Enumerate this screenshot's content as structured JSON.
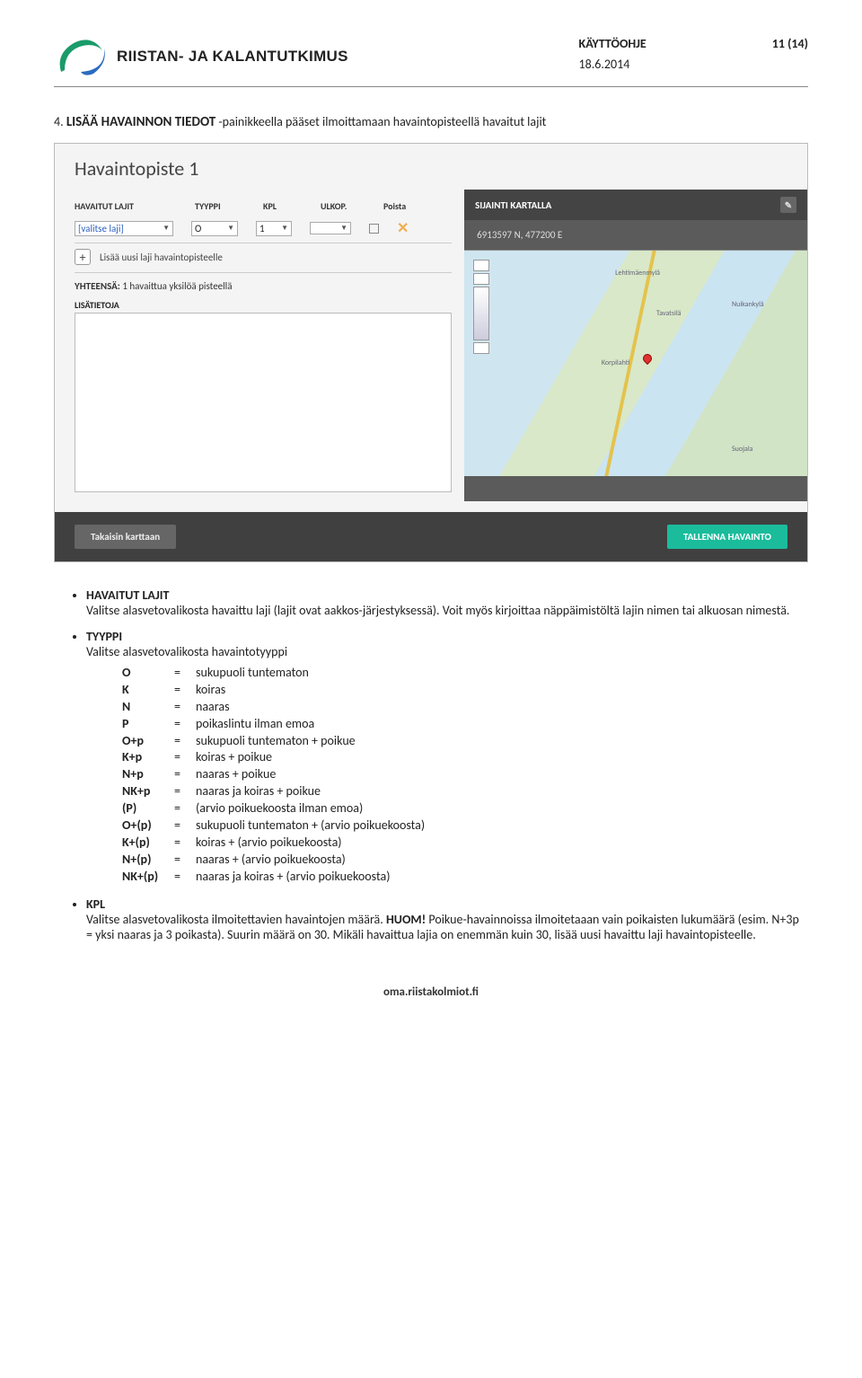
{
  "header": {
    "org_name": "RIISTAN- JA KALANTUTKIMUS",
    "doc_type": "KÄYTTÖOHJE",
    "page": "11 (14)",
    "date": "18.6.2014"
  },
  "section": {
    "number": "4.",
    "title": "LISÄÄ HAVAINNON TIEDOT",
    "rest": " -painikkeella pääset ilmoittamaan havaintopisteellä havaitut lajit"
  },
  "panel": {
    "title": "Havaintopiste 1",
    "cols": {
      "c1": "HAVAITUT LAJIT",
      "c2": "TYYPPI",
      "c3": "KPL",
      "c4": "ULKOP.",
      "c5": "Poista"
    },
    "row": {
      "laji": "[valitse laji]",
      "tyyppi": "O",
      "kpl": "1",
      "ulkop": ""
    },
    "add": "Lisää uusi laji havaintopisteelle",
    "summary_lbl": "YHTEENSÄ:",
    "summary_txt": " 1 havaittua yksilöä pisteellä",
    "ta_label": "LISÄTIETOJA",
    "loc_title": "SIJAINTI KARTALLA",
    "coords": "6913597 N, 477200 E",
    "map_labels": {
      "a": "Korpilahti",
      "b": "Tavatsilä",
      "c": "Suojala",
      "d": "Nuikankylä",
      "e": "Lehtimäenmylä"
    },
    "btn_back": "Takaisin karttaan",
    "btn_save": "TALLENNA HAVAINTO"
  },
  "bullets": {
    "b1_title": "HAVAITUT LAJIT",
    "b1_text": "Valitse alasvetovalikosta havaittu laji (lajit ovat aakkos-järjestyksessä). Voit myös kirjoittaa näppäimistöltä lajin nimen tai alkuosan nimestä.",
    "b2_title": "TYYPPI",
    "b2_text": "Valitse alasvetovalikosta havaintotyyppi",
    "types": [
      {
        "k": "O",
        "v": "sukupuoli tuntematon"
      },
      {
        "k": "K",
        "v": "koiras"
      },
      {
        "k": "N",
        "v": "naaras"
      },
      {
        "k": "P",
        "v": "poikaslintu ilman emoa"
      },
      {
        "k": "O+p",
        "v": "sukupuoli tuntematon + poikue"
      },
      {
        "k": "K+p",
        "v": "koiras + poikue"
      },
      {
        "k": "N+p",
        "v": "naaras + poikue"
      },
      {
        "k": "NK+p",
        "v": "naaras ja koiras + poikue"
      },
      {
        "k": "(P)",
        "v": "(arvio poikuekoosta ilman emoa)"
      },
      {
        "k": "O+(p)",
        "v": "sukupuoli tuntematon + (arvio poikuekoosta)"
      },
      {
        "k": "K+(p)",
        "v": "koiras + (arvio poikuekoosta)"
      },
      {
        "k": "N+(p)",
        "v": "naaras + (arvio poikuekoosta)"
      },
      {
        "k": "NK+(p)",
        "v": "naaras ja koiras + (arvio poikuekoosta)"
      }
    ],
    "b3_title": "KPL",
    "b3_text_a": "Valitse alasvetovalikosta ilmoitettavien havaintojen määrä. ",
    "b3_huom": "HUOM!",
    "b3_text_b": " Poikue-havainnoissa ilmoitetaaan vain poikaisten lukumäärä (esim. N+3p = yksi naaras ja 3 poikasta). Suurin määrä on 30. Mikäli havaittua lajia on enemmän kuin 30, lisää uusi havaittu laji havaintopisteelle."
  },
  "footer": "oma.riistakolmiot.fi"
}
